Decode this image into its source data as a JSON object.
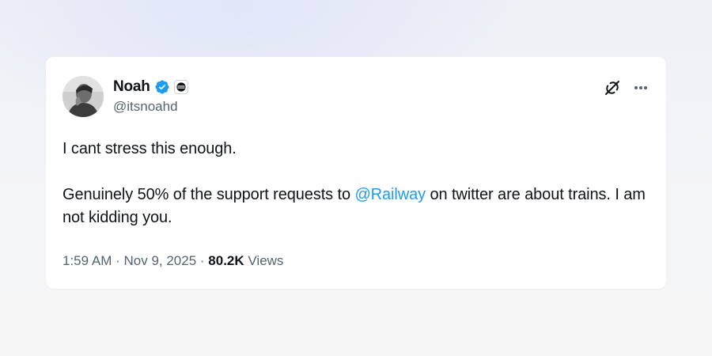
{
  "author": {
    "display_name": "Noah",
    "handle": "@itsnoahd",
    "verified": true,
    "affiliation_badge": "railway-logo-icon"
  },
  "actions": {
    "link_icon": "link-off-icon",
    "more_icon": "more-horizontal-icon"
  },
  "tweet": {
    "line1": "I cant stress this enough.",
    "para2_before": "Genuinely 50% of the support requests to ",
    "mention": "@Railway",
    "para2_after": " on twitter are about trains. I am not kidding you."
  },
  "meta": {
    "time": "1:59 AM",
    "sep1": " · ",
    "date": "Nov 9, 2025",
    "sep2": " · ",
    "views_count": "80.2K",
    "views_label": " Views"
  },
  "colors": {
    "accent": "#1d9bf0",
    "text": "#0f1419",
    "muted": "#536471"
  }
}
